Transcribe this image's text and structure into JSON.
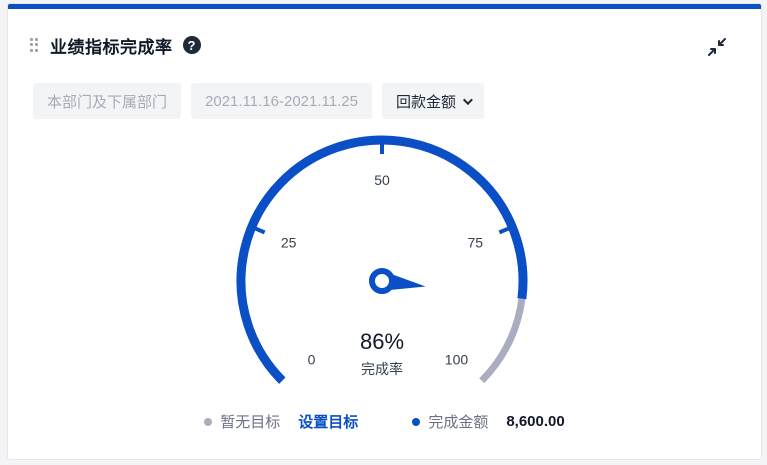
{
  "header": {
    "title": "业绩指标完成率",
    "help_symbol": "?"
  },
  "filters": {
    "department": "本部门及下属部门",
    "date_range": "2021.11.16-2021.11.25",
    "metric": "回款金额"
  },
  "gauge": {
    "ticks": [
      "0",
      "25",
      "50",
      "75",
      "100"
    ],
    "percent_label": "86%",
    "caption": "完成率",
    "value_fraction": 0.86,
    "colors": {
      "filled": "#0b4fc7",
      "remaining": "#a9adbf",
      "text": "#374151"
    }
  },
  "legend": {
    "no_target": "暂无目标",
    "set_target": "设置目标",
    "completed_label": "完成金额",
    "completed_value": "8,600.00",
    "no_target_color": "#a9adbf",
    "completed_color": "#0b4fc7"
  }
}
